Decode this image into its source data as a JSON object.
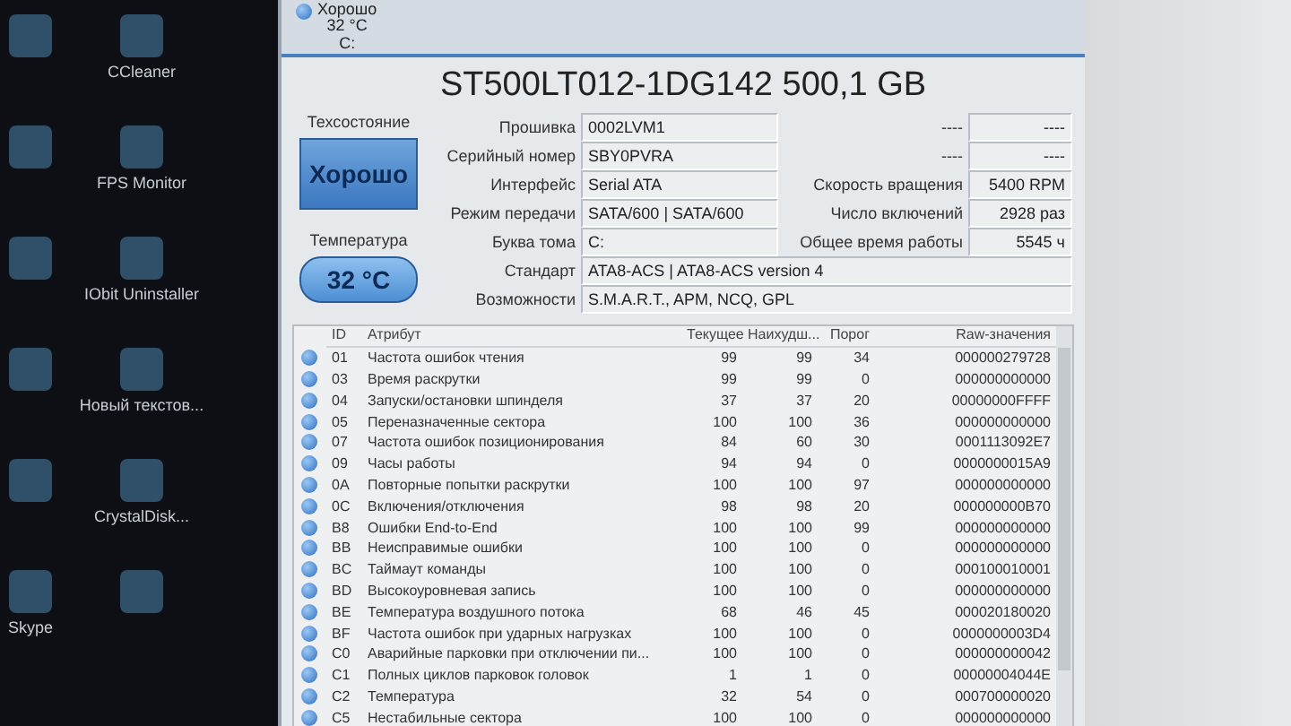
{
  "desktop": {
    "shortcuts": [
      "CCleaner",
      "FPS Monitor",
      "IObit Uninstaller",
      "Новый текстов...",
      "CrystalDisk...",
      "Skype"
    ]
  },
  "disk_tab": {
    "status": "Хорошо",
    "temperature": "32 °C",
    "letter": "C:"
  },
  "title": "ST500LT012-1DG142 500,1 GB",
  "health": {
    "label": "Техсостояние",
    "value": "Хорошо"
  },
  "temperature": {
    "label": "Температура",
    "value": "32 °C"
  },
  "info_rows": [
    {
      "label": "Прошивка",
      "value": "0002LVM1",
      "right_label": "----",
      "right_value": "----"
    },
    {
      "label": "Серийный номер",
      "value": "SBY0PVRA",
      "right_label": "----",
      "right_value": "----"
    },
    {
      "label": "Интерфейс",
      "value": "Serial ATA",
      "right_label": "Скорость вращения",
      "right_value": "5400 RPM"
    },
    {
      "label": "Режим передачи",
      "value": "SATA/600 | SATA/600",
      "right_label": "Число включений",
      "right_value": "2928 раз"
    },
    {
      "label": "Буква тома",
      "value": "C:",
      "right_label": "Общее время работы",
      "right_value": "5545 ч"
    },
    {
      "label": "Стандарт",
      "value": "ATA8-ACS | ATA8-ACS version 4"
    },
    {
      "label": "Возможности",
      "value": "S.M.A.R.T., APM, NCQ, GPL"
    }
  ],
  "table": {
    "columns": [
      "ID",
      "Атрибут",
      "Текущее",
      "Наихудш...",
      "Порог",
      "Raw-значения"
    ],
    "rows": [
      [
        "01",
        "Частота ошибок чтения",
        "99",
        "99",
        "34",
        "000000279728"
      ],
      [
        "03",
        "Время раскрутки",
        "99",
        "99",
        "0",
        "000000000000"
      ],
      [
        "04",
        "Запуски/остановки шпинделя",
        "37",
        "37",
        "20",
        "00000000FFFF"
      ],
      [
        "05",
        "Переназначенные сектора",
        "100",
        "100",
        "36",
        "000000000000"
      ],
      [
        "07",
        "Частота ошибок позиционирования",
        "84",
        "60",
        "30",
        "0001113092E7"
      ],
      [
        "09",
        "Часы работы",
        "94",
        "94",
        "0",
        "0000000015A9"
      ],
      [
        "0A",
        "Повторные попытки раскрутки",
        "100",
        "100",
        "97",
        "000000000000"
      ],
      [
        "0C",
        "Включения/отключения",
        "98",
        "98",
        "20",
        "000000000B70"
      ],
      [
        "B8",
        "Ошибки End-to-End",
        "100",
        "100",
        "99",
        "000000000000"
      ],
      [
        "BB",
        "Неисправимые ошибки",
        "100",
        "100",
        "0",
        "000000000000"
      ],
      [
        "BC",
        "Таймаут команды",
        "100",
        "100",
        "0",
        "000100010001"
      ],
      [
        "BD",
        "Высокоуровневая запись",
        "100",
        "100",
        "0",
        "000000000000"
      ],
      [
        "BE",
        "Температура воздушного потока",
        "68",
        "46",
        "45",
        "000020180020"
      ],
      [
        "BF",
        "Частота ошибок при ударных нагрузках",
        "100",
        "100",
        "0",
        "0000000003D4"
      ],
      [
        "C0",
        "Аварийные парковки при отключении пи...",
        "100",
        "100",
        "0",
        "000000000042"
      ],
      [
        "C1",
        "Полных циклов парковок головок",
        "1",
        "1",
        "0",
        "00000004044E"
      ],
      [
        "C2",
        "Температура",
        "32",
        "54",
        "0",
        "000700000020"
      ],
      [
        "C5",
        "Нестабильные сектора",
        "100",
        "100",
        "0",
        "000000000000"
      ]
    ]
  }
}
